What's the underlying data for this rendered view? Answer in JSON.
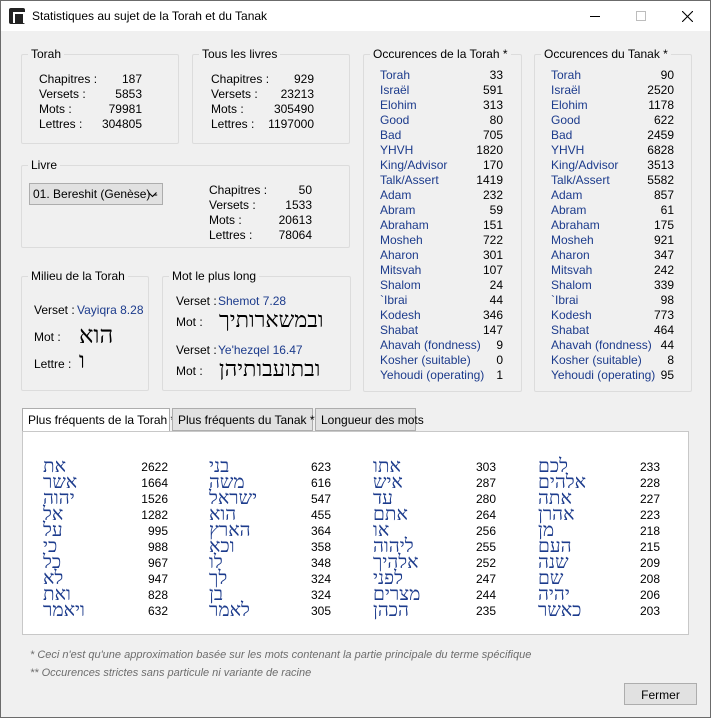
{
  "window": {
    "title": "Statistiques au sujet de la Torah et du Tanak"
  },
  "torah": {
    "title": "Torah",
    "stats": [
      {
        "label": "Chapitres :",
        "value": "187"
      },
      {
        "label": "Versets :",
        "value": "5853"
      },
      {
        "label": "Mots :",
        "value": "79981"
      },
      {
        "label": "Lettres :",
        "value": "304805"
      }
    ]
  },
  "all_books": {
    "title": "Tous les livres",
    "stats": [
      {
        "label": "Chapitres :",
        "value": "929"
      },
      {
        "label": "Versets :",
        "value": "23213"
      },
      {
        "label": "Mots :",
        "value": "305490"
      },
      {
        "label": "Lettres :",
        "value": "1197000"
      }
    ]
  },
  "book": {
    "title": "Livre",
    "selected": "01. Bereshit (Genèse) -",
    "stats": [
      {
        "label": "Chapitres :",
        "value": "50"
      },
      {
        "label": "Versets :",
        "value": "1533"
      },
      {
        "label": "Mots :",
        "value": "20613"
      },
      {
        "label": "Lettres :",
        "value": "78064"
      }
    ]
  },
  "middle": {
    "title": "Milieu de la Torah",
    "verse_label": "Verset :",
    "verse_ref": "Vayiqra 8.28",
    "word_label": "Mot :",
    "word": "הוא",
    "letter_label": "Lettre :",
    "letter": "ו"
  },
  "longest": {
    "title": "Mot le plus long",
    "verse1_label": "Verset :",
    "verse1_ref": "Shemot 7.28",
    "word1_label": "Mot :",
    "word1": "ובמשארותיך",
    "verse2_label": "Verset :",
    "verse2_ref": "Ye'hezqel 16.47",
    "word2_label": "Mot :",
    "word2": "ובתועבותיהן"
  },
  "occ_torah": {
    "title": "Occurences de la Torah *",
    "rows": [
      {
        "label": "Torah",
        "value": "33"
      },
      {
        "label": "Israël",
        "value": "591"
      },
      {
        "label": "Elohim",
        "value": "313"
      },
      {
        "label": "Good",
        "value": "80"
      },
      {
        "label": "Bad",
        "value": "705"
      },
      {
        "label": "YHVH",
        "value": "1820"
      },
      {
        "label": "King/Advisor",
        "value": "170"
      },
      {
        "label": "Talk/Assert",
        "value": "1419"
      },
      {
        "label": "Adam",
        "value": "232"
      },
      {
        "label": "Abram",
        "value": "59"
      },
      {
        "label": "Abraham",
        "value": "151"
      },
      {
        "label": "Mosheh",
        "value": "722"
      },
      {
        "label": "Aharon",
        "value": "301"
      },
      {
        "label": "Mitsvah",
        "value": "107"
      },
      {
        "label": "Shalom",
        "value": "24"
      },
      {
        "label": "`Ibrai",
        "value": "44"
      },
      {
        "label": "Kodesh",
        "value": "346"
      },
      {
        "label": "Shabat",
        "value": "147"
      },
      {
        "label": "Ahavah (fondness)",
        "value": "9"
      },
      {
        "label": "Kosher (suitable)",
        "value": "0"
      },
      {
        "label": "Yehoudi (operating)",
        "value": "1"
      }
    ]
  },
  "occ_tanak": {
    "title": "Occurences du Tanak *",
    "rows": [
      {
        "label": "Torah",
        "value": "90"
      },
      {
        "label": "Israël",
        "value": "2520"
      },
      {
        "label": "Elohim",
        "value": "1178"
      },
      {
        "label": "Good",
        "value": "622"
      },
      {
        "label": "Bad",
        "value": "2459"
      },
      {
        "label": "YHVH",
        "value": "6828"
      },
      {
        "label": "King/Advisor",
        "value": "3513"
      },
      {
        "label": "Talk/Assert",
        "value": "5582"
      },
      {
        "label": "Adam",
        "value": "857"
      },
      {
        "label": "Abram",
        "value": "61"
      },
      {
        "label": "Abraham",
        "value": "175"
      },
      {
        "label": "Mosheh",
        "value": "921"
      },
      {
        "label": "Aharon",
        "value": "347"
      },
      {
        "label": "Mitsvah",
        "value": "242"
      },
      {
        "label": "Shalom",
        "value": "339"
      },
      {
        "label": "`Ibrai",
        "value": "98"
      },
      {
        "label": "Kodesh",
        "value": "773"
      },
      {
        "label": "Shabat",
        "value": "464"
      },
      {
        "label": "Ahavah (fondness)",
        "value": "44"
      },
      {
        "label": "Kosher (suitable)",
        "value": "8"
      },
      {
        "label": "Yehoudi (operating)",
        "value": "95"
      }
    ]
  },
  "tabs": [
    {
      "label": "Plus fréquents de la Torah **",
      "active": true
    },
    {
      "label": "Plus fréquents du Tanak **",
      "active": false
    },
    {
      "label": "Longueur des mots",
      "active": false
    }
  ],
  "frequent_words": [
    [
      {
        "word": "את",
        "count": "2622"
      },
      {
        "word": "אשר",
        "count": "1664"
      },
      {
        "word": "יהוה",
        "count": "1526"
      },
      {
        "word": "אל",
        "count": "1282"
      },
      {
        "word": "על",
        "count": "995"
      },
      {
        "word": "כי",
        "count": "988"
      },
      {
        "word": "כל",
        "count": "967"
      },
      {
        "word": "לא",
        "count": "947"
      },
      {
        "word": "ואת",
        "count": "828"
      },
      {
        "word": "ויאמר",
        "count": "632"
      }
    ],
    [
      {
        "word": "בני",
        "count": "623"
      },
      {
        "word": "משה",
        "count": "616"
      },
      {
        "word": "ישראל",
        "count": "547"
      },
      {
        "word": "הוא",
        "count": "455"
      },
      {
        "word": "הארץ",
        "count": "364"
      },
      {
        "word": "וכא",
        "count": "358"
      },
      {
        "word": "לו",
        "count": "348"
      },
      {
        "word": "לך",
        "count": "324"
      },
      {
        "word": "בן",
        "count": "324"
      },
      {
        "word": "לאמר",
        "count": "305"
      }
    ],
    [
      {
        "word": "אתו",
        "count": "303"
      },
      {
        "word": "איש",
        "count": "287"
      },
      {
        "word": "עד",
        "count": "280"
      },
      {
        "word": "אתם",
        "count": "264"
      },
      {
        "word": "או",
        "count": "256"
      },
      {
        "word": "ליהוה",
        "count": "255"
      },
      {
        "word": "אלהיך",
        "count": "252"
      },
      {
        "word": "לפני",
        "count": "247"
      },
      {
        "word": "מצרים",
        "count": "244"
      },
      {
        "word": "הכהן",
        "count": "235"
      }
    ],
    [
      {
        "word": "לכם",
        "count": "233"
      },
      {
        "word": "אלהים",
        "count": "228"
      },
      {
        "word": "אתה",
        "count": "227"
      },
      {
        "word": "אהרן",
        "count": "223"
      },
      {
        "word": "מן",
        "count": "218"
      },
      {
        "word": "העם",
        "count": "215"
      },
      {
        "word": "שנה",
        "count": "209"
      },
      {
        "word": "שם",
        "count": "208"
      },
      {
        "word": "יהיה",
        "count": "206"
      },
      {
        "word": "כאשר",
        "count": "203"
      }
    ]
  ],
  "notes": {
    "note1": "* Ceci n'est qu'une approximation basée sur les mots contenant la partie principale du terme spécifique",
    "note2": "** Occurences strictes sans particule ni variante de racine"
  },
  "close_label": "Fermer",
  "accent_color": "#1c3b8c"
}
